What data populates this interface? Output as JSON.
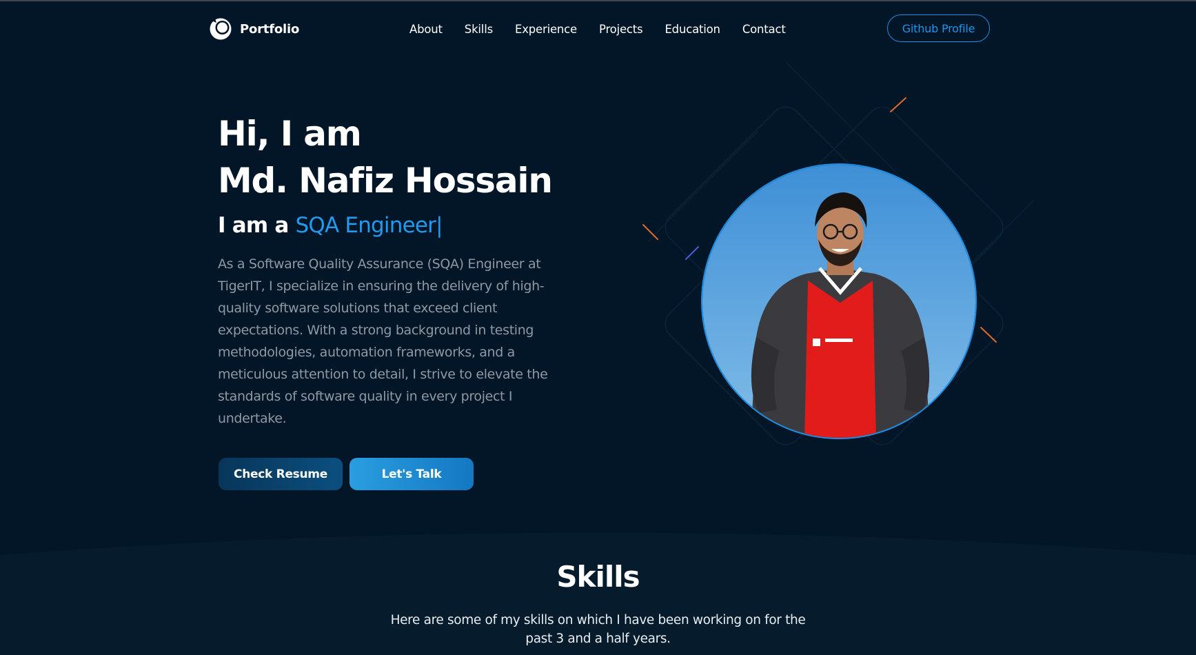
{
  "nav": {
    "brand": "Portfolio",
    "links": [
      "About",
      "Skills",
      "Experience",
      "Projects",
      "Education",
      "Contact"
    ],
    "github_label": "Github Profile"
  },
  "hero": {
    "greeting": "Hi, I am",
    "name": "Md. Nafiz Hossain",
    "role_prefix": "I am a",
    "role": "SQA Engineer",
    "caret": "|",
    "intro": "As a Software Quality Assurance (SQA) Engineer at TigerIT, I specialize in ensuring the delivery of high-quality software solutions that exceed client expectations. With a strong background in testing methodologies, automation frameworks, and a meticulous attention to detail, I strive to elevate the standards of software quality in every project I undertake.",
    "resume_button": "Check Resume",
    "talk_button": "Let's Talk"
  },
  "skills": {
    "title": "Skills",
    "description": "Here are some of my skills on which I have been working on for the past 3 and a half years."
  },
  "icons": {
    "logo": "portfolio-logo-icon"
  },
  "colors": {
    "background": "#021628",
    "accent": "#1f9bef",
    "muted_text": "#8f99a4"
  }
}
